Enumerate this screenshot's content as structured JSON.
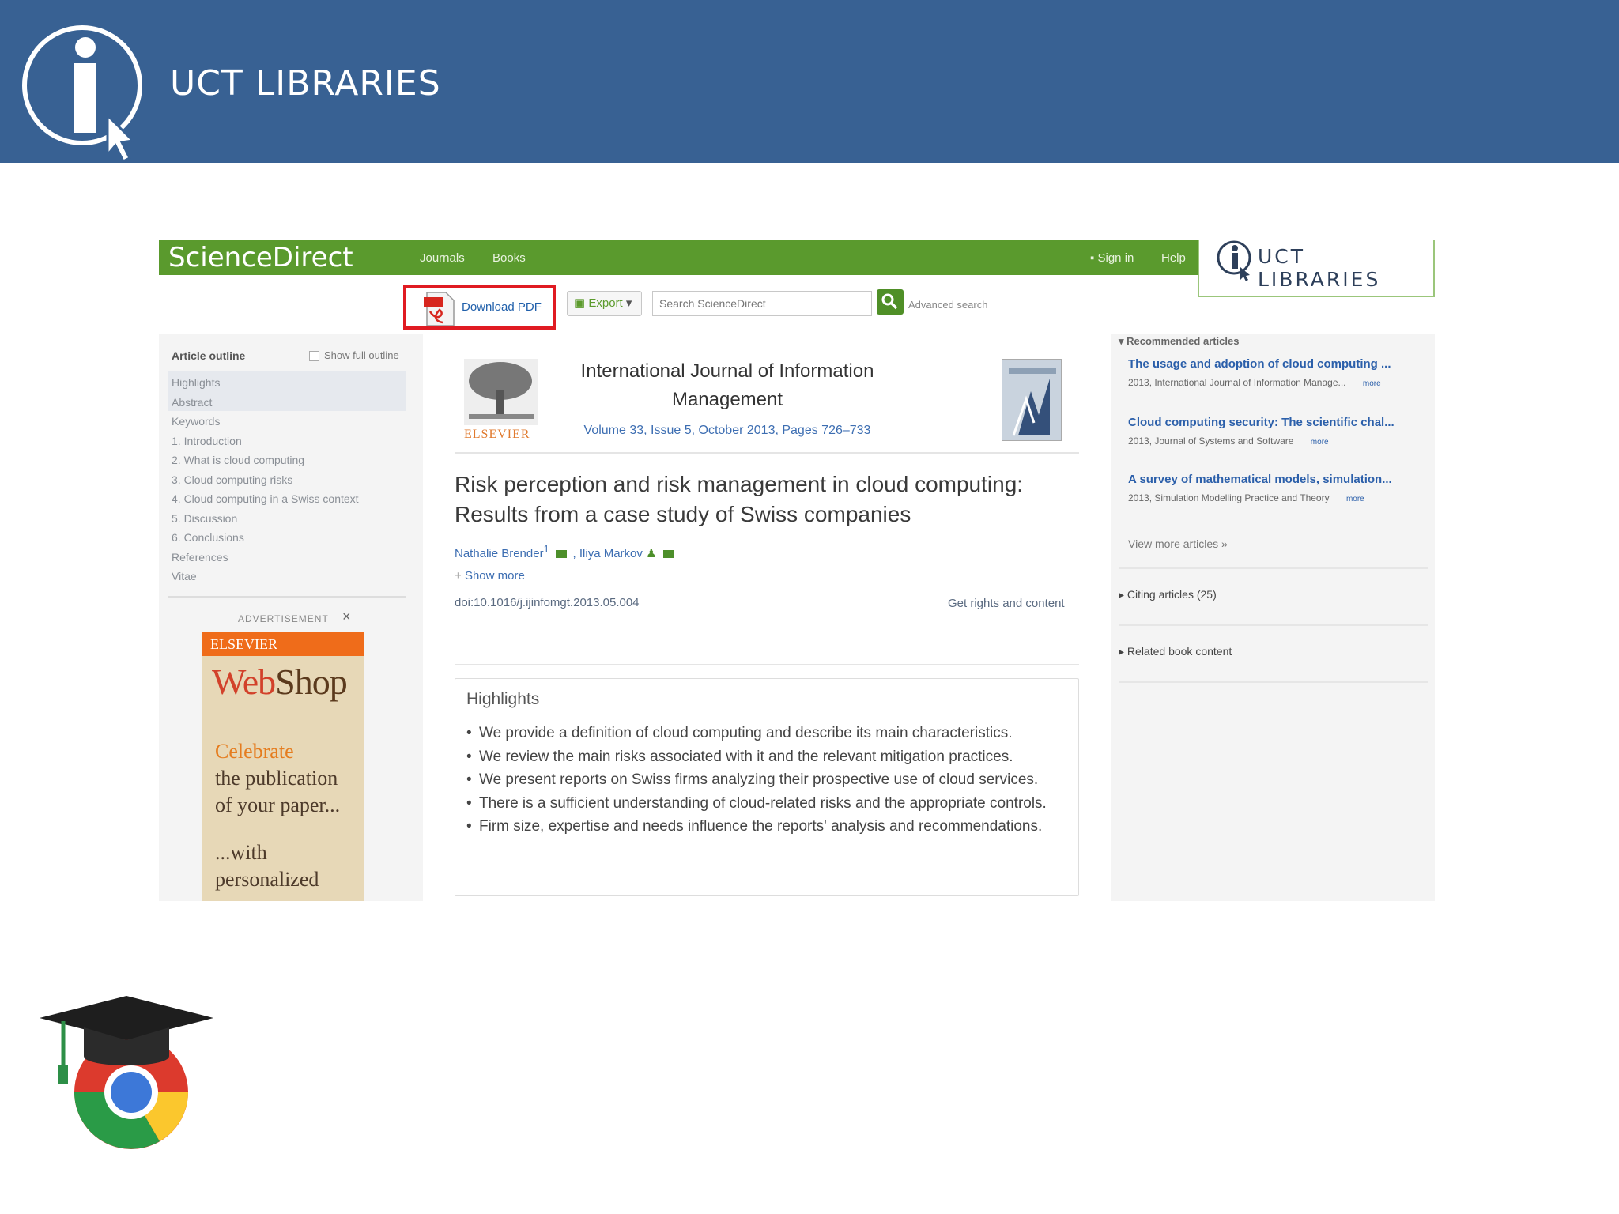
{
  "slide": {
    "title": "UCT LIBRARIES"
  },
  "sciencedirect": {
    "logo": "ScienceDirect",
    "nav": [
      "Journals",
      "Books"
    ],
    "sign_in": "Sign in",
    "help": "Help",
    "badge": "UCT LIBRARIES"
  },
  "toolbar": {
    "download_pdf": "Download PDF",
    "export": "Export",
    "search_placeholder": "Search ScienceDirect",
    "advanced_search": "Advanced search"
  },
  "outline": {
    "title": "Article outline",
    "show_full": "Show full outline",
    "items": [
      "Highlights",
      "Abstract",
      "Keywords",
      "1. Introduction",
      "2. What is cloud computing",
      "3. Cloud computing risks",
      "4. Cloud computing in a Swiss context",
      "5. Discussion",
      "6. Conclusions",
      "References",
      "Vitae"
    ]
  },
  "advertisement": {
    "label": "ADVERTISEMENT",
    "close": "×",
    "brand_bar": "ELSEVIER",
    "brand_web": "Web",
    "brand_shop": "Shop",
    "line1": "Celebrate",
    "line2": "the publication",
    "line3": "of your paper...",
    "line4": "...with",
    "line5": "personalized"
  },
  "article": {
    "journal": "International Journal of Information Management",
    "volume_info": "Volume 33, Issue 5, October 2013, Pages 726–733",
    "publisher_logo": "ELSEVIER",
    "title": "Risk perception and risk management in cloud computing: Results from a case study of Swiss companies",
    "author1": "Nathalie Brender",
    "author1_sup": "1",
    "author2": "Iliya Markov",
    "show_more": "Show more",
    "doi": "doi:10.1016/j.ijinfomgt.2013.05.004",
    "rights": "Get rights and content",
    "highlights_title": "Highlights",
    "highlights": [
      "We provide a definition of cloud computing and describe its main characteristics.",
      "We review the main risks associated with it and the relevant mitigation practices.",
      "We present reports on Swiss firms analyzing their prospective use of cloud services.",
      "There is a sufficient understanding of cloud-related risks and the appropriate controls.",
      "Firm size, expertise and needs influence the reports' analysis and recommendations."
    ]
  },
  "recommended": {
    "title": "Recommended articles",
    "items": [
      {
        "title": "The usage and adoption of cloud computing ...",
        "meta": "2013, International Journal of Information Manage...",
        "more": "more"
      },
      {
        "title": "Cloud computing security: The scientific chal...",
        "meta": "2013, Journal of Systems and Software",
        "more": "more"
      },
      {
        "title": "A survey of mathematical models, simulation...",
        "meta": "2013, Simulation Modelling Practice and Theory",
        "more": "more"
      }
    ],
    "view_more": "View more articles »",
    "citing": "Citing articles (25)",
    "related": "Related book content"
  },
  "colors": {
    "header": "#386193",
    "sd_green": "#5a9a2d",
    "highlight_red": "#e01b22",
    "link": "#2b5faa"
  }
}
